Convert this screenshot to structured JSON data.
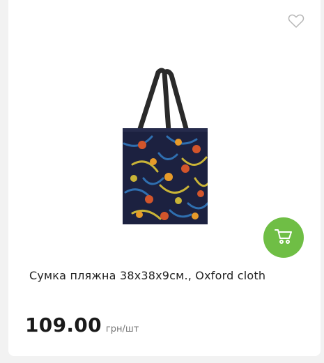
{
  "product": {
    "title": "Сумка пляжна 38х38х9см., Oxford cloth",
    "price": "109.00",
    "unit": "грн/шт",
    "image_icon": "tote-bag-image"
  },
  "actions": {
    "wishlist_icon": "heart-icon",
    "cart_icon": "cart-icon"
  },
  "colors": {
    "accent": "#6fbe45",
    "bag_fabric": "#1c2140",
    "leaf_blue": "#2f6fb0",
    "leaf_yellow": "#c9b437",
    "flower_red": "#d2552b",
    "flower_orange": "#e69a2a"
  }
}
